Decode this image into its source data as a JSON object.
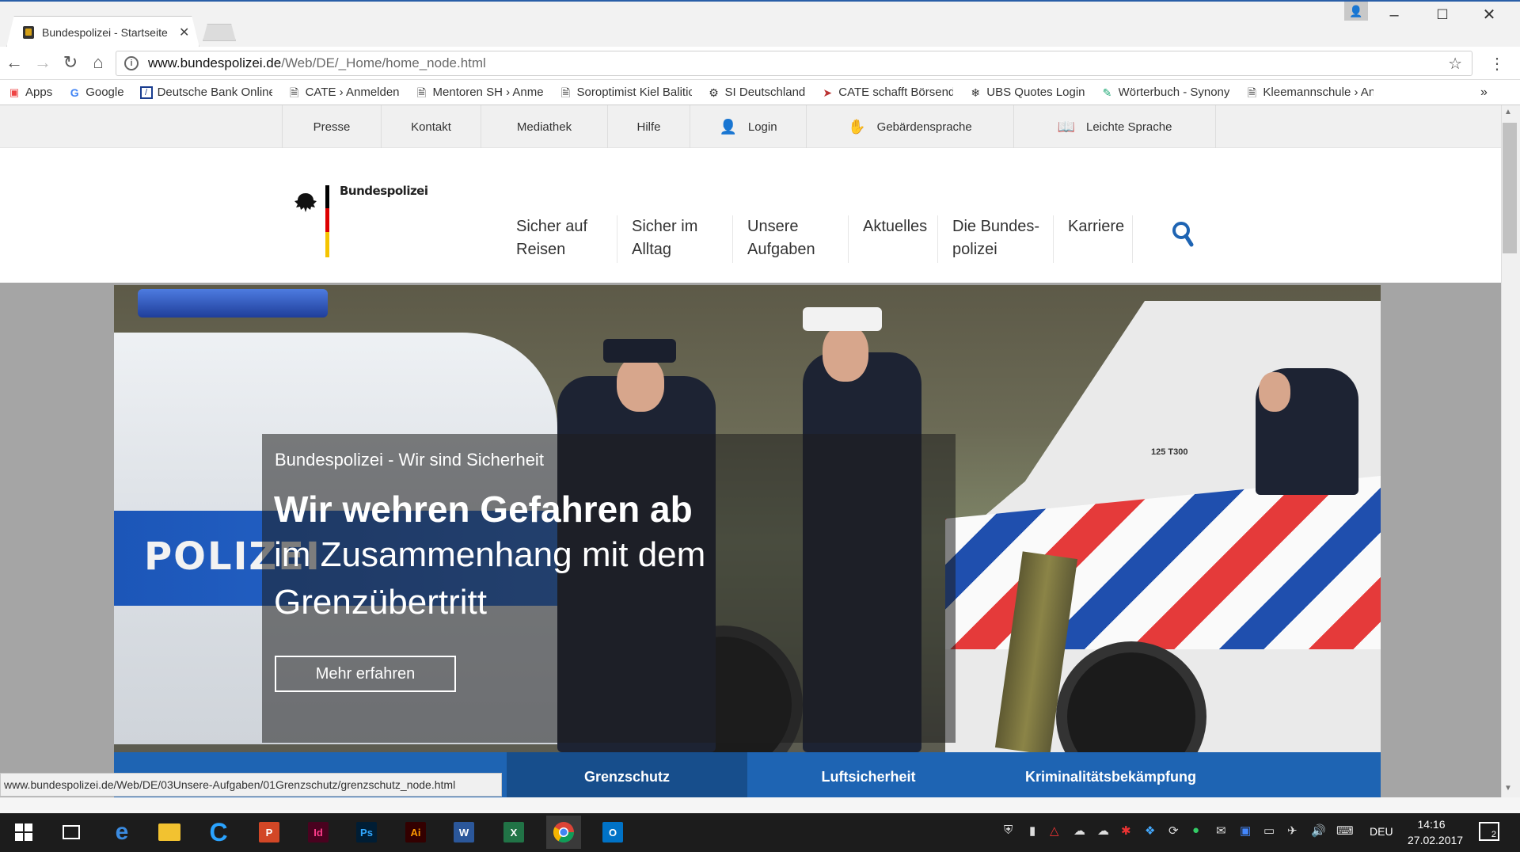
{
  "browser": {
    "tab_title": "Bundespolizei - Startseite",
    "url_domain": "www.bundespolizei.de",
    "url_path": "/Web/DE/_Home/home_node.html",
    "bookmarks": [
      {
        "icon": "apps-grid-icon",
        "label": "Apps"
      },
      {
        "icon": "google-icon",
        "label": "Google"
      },
      {
        "icon": "deutsche-bank-icon",
        "label": "Deutsche Bank Online"
      },
      {
        "icon": "page-icon",
        "label": "CATE › Anmelden"
      },
      {
        "icon": "page-icon",
        "label": "Mentoren SH › Anmel"
      },
      {
        "icon": "page-icon",
        "label": "Soroptimist Kiel Balitic"
      },
      {
        "icon": "si-icon",
        "label": "SI Deutschland"
      },
      {
        "icon": "cate-icon",
        "label": "CATE schafft Börsend"
      },
      {
        "icon": "ubs-icon",
        "label": "UBS Quotes Login"
      },
      {
        "icon": "woerterbuch-icon",
        "label": "Wörterbuch - Synony"
      },
      {
        "icon": "page-icon",
        "label": "Kleemannschule › Anr"
      }
    ],
    "status_url": "www.bundespolizei.de/Web/DE/03Unsere-Aufgaben/01Grenzschutz/grenzschutz_node.html"
  },
  "site": {
    "topnav": [
      "Presse",
      "Kontakt",
      "Mediathek",
      "Hilfe",
      "Login",
      "Gebärdensprache",
      "Leichte Sprache"
    ],
    "logo_text": "Bundespolizei",
    "mainnav": [
      {
        "l1": "Sicher auf",
        "l2": "Reisen"
      },
      {
        "l1": "Sicher im",
        "l2": "Alltag"
      },
      {
        "l1": "Unsere",
        "l2": "Aufgaben"
      },
      {
        "l1": "Aktuelles",
        "l2": ""
      },
      {
        "l1": "Die Bundes-",
        "l2": "polizei"
      },
      {
        "l1": "Karriere",
        "l2": ""
      }
    ],
    "hero": {
      "photo_text": "POLIZEI",
      "van_text": "125 T300",
      "subtitle": "Bundespolizei - Wir sind Sicherheit",
      "headline_bold": "Wir wehren Gefahren ab",
      "headline_2": "im Zusammenhang mit dem",
      "headline_3": "Grenzübertritt",
      "button": "Mehr erfahren"
    },
    "tabs": [
      "Grenzschutz",
      "Luftsicherheit",
      "Kriminalitätsbekämpfung"
    ]
  },
  "taskbar": {
    "lang": "DEU",
    "time": "14:16",
    "date": "27.02.2017",
    "notifications": "2"
  },
  "colors": {
    "tab_blue": "#1e64b3",
    "active_tab": "#174e8c",
    "accent": "#2a5fa8"
  }
}
